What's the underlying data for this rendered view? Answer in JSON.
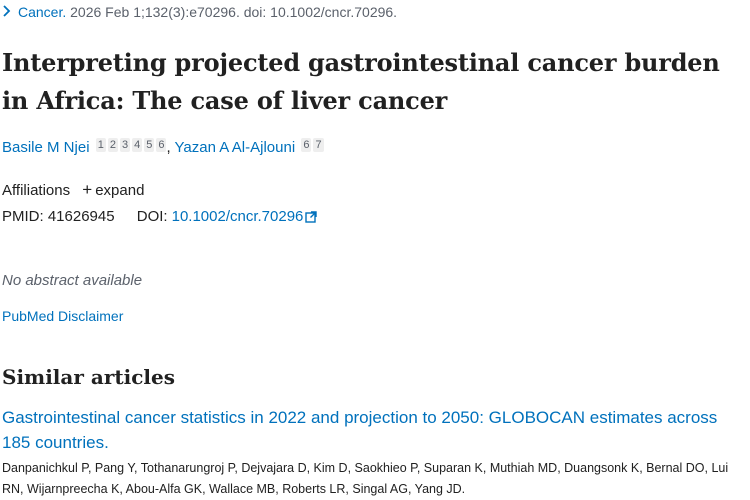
{
  "citation": {
    "journal": "Cancer.",
    "details": " 2026 Feb 1;132(3):e70296. doi: 10.1002/cncr.70296."
  },
  "title": "Interpreting projected gastrointestinal cancer burden in Africa: The case of liver cancer",
  "authors": [
    {
      "name": "Basile M Njei",
      "affiliations": [
        "1",
        "2",
        "3",
        "4",
        "5",
        "6"
      ]
    },
    {
      "name": "Yazan A Al-Ajlouni",
      "affiliations": [
        "6",
        "7"
      ]
    }
  ],
  "author_separator": ",",
  "affiliations": {
    "label": "Affiliations",
    "expand_label": "expand"
  },
  "ids": {
    "pmid_label": "PMID:",
    "pmid": "41626945",
    "doi_label": "DOI:",
    "doi": "10.1002/cncr.70296"
  },
  "no_abstract": "No abstract available",
  "disclaimer": "PubMed Disclaimer",
  "similar": {
    "heading": "Similar articles",
    "items": [
      {
        "title": "Gastrointestinal cancer statistics in 2022 and projection to 2050: GLOBOCAN estimates across 185 countries.",
        "authors": "Danpanichkul P, Pang Y, Tothanarungroj P, Dejvajara D, Kim D, Saokhieo P, Suparan K, Muthiah MD, Duangsonk K, Bernal DO, Lui RN, Wijarnpreecha K, Abou-Alfa GK, Wallace MB, Roberts LR, Singal AG, Yang JD."
      }
    ]
  },
  "colors": {
    "link": "#0071bc",
    "text": "#212121",
    "muted": "#5b616b"
  },
  "icons": {
    "chevron": "chevron-right-icon",
    "plus": "plus-icon",
    "external": "external-link-icon"
  }
}
